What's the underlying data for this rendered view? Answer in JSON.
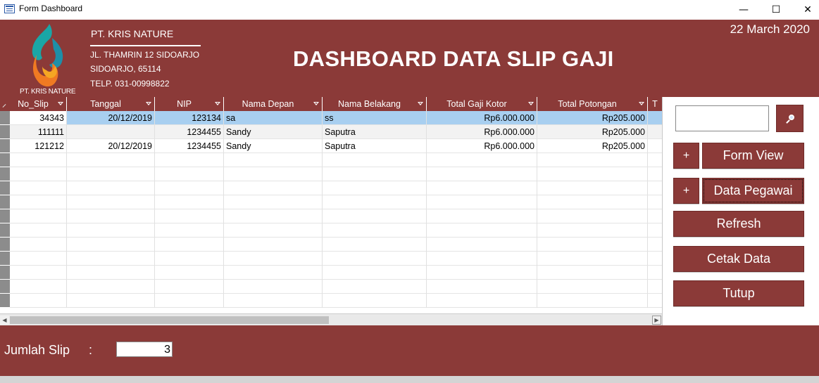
{
  "window": {
    "title": "Form Dashboard",
    "minimize": "—",
    "maximize": "☐",
    "close": "✕"
  },
  "header": {
    "logo_caption": "PT. KRIS NATURE",
    "company_name": "PT. KRIS NATURE",
    "address_line1": "JL. THAMRIN 12 SIDOARJO",
    "address_line2": "SIDOARJO, 65114",
    "phone": "TELP. 031-00998822",
    "title": "DASHBOARD DATA SLIP GAJI",
    "date": "22 March 2020"
  },
  "colors": {
    "brand": "#8b3a38",
    "selected_row": "#a8cff0"
  },
  "table": {
    "columns": [
      "No_Slip",
      "Tanggal",
      "NIP",
      "Nama Depan",
      "Nama Belakang",
      "Total Gaji Kotor",
      "Total Potongan",
      "T"
    ],
    "rows": [
      [
        "34343",
        "20/12/2019",
        "123134",
        "sa",
        "ss",
        "Rp6.000.000",
        "Rp205.000",
        ""
      ],
      [
        "111111",
        "",
        "1234455",
        "Sandy",
        "Saputra",
        "Rp6.000.000",
        "Rp205.000",
        ""
      ],
      [
        "121212",
        "20/12/2019",
        "1234455",
        "Sandy",
        "Saputra",
        "Rp6.000.000",
        "Rp205.000",
        ""
      ]
    ],
    "selected_row_index": 0
  },
  "panel": {
    "search_value": "",
    "search_icon": "magnifier-icon",
    "plus_label": "+",
    "form_view_label": "Form View",
    "data_pegawai_label": "Data Pegawai",
    "refresh_label": "Refresh",
    "cetak_label": "Cetak Data",
    "tutup_label": "Tutup"
  },
  "footer": {
    "jumlah_label": "Jumlah Slip",
    "colon": ":",
    "jumlah_value": "3"
  }
}
